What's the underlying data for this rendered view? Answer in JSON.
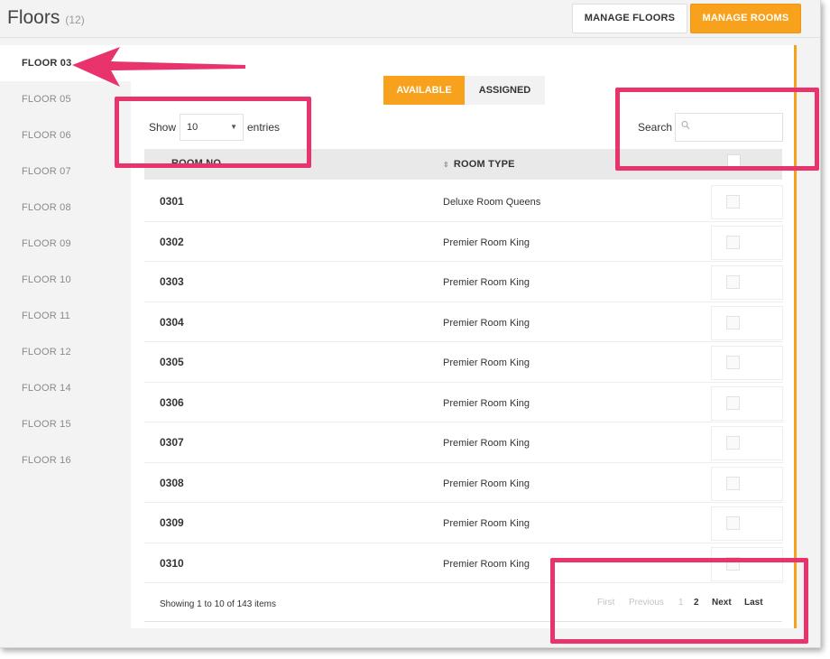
{
  "header": {
    "title": "Floors",
    "count": "(12)",
    "manage_floors_label": "MANAGE FLOORS",
    "manage_rooms_label": "MANAGE ROOMS"
  },
  "sidebar": {
    "items": [
      {
        "label": "FLOOR 03",
        "active": true
      },
      {
        "label": "FLOOR 05"
      },
      {
        "label": "FLOOR 06"
      },
      {
        "label": "FLOOR 07"
      },
      {
        "label": "FLOOR 08"
      },
      {
        "label": "FLOOR 09"
      },
      {
        "label": "FLOOR 10"
      },
      {
        "label": "FLOOR 11"
      },
      {
        "label": "FLOOR 12"
      },
      {
        "label": "FLOOR 14"
      },
      {
        "label": "FLOOR 15"
      },
      {
        "label": "FLOOR 16"
      }
    ]
  },
  "tabs": {
    "available": "AVAILABLE",
    "assigned": "ASSIGNED"
  },
  "controls": {
    "show_label": "Show",
    "page_size": "10",
    "entries_label": "entries",
    "search_label": "Search",
    "search_value": ""
  },
  "table": {
    "col_room": "ROOM NO",
    "col_type": "ROOM TYPE",
    "rows": [
      {
        "room": "0301",
        "type": "Deluxe Room Queens"
      },
      {
        "room": "0302",
        "type": "Premier Room King"
      },
      {
        "room": "0303",
        "type": "Premier Room King"
      },
      {
        "room": "0304",
        "type": "Premier Room King"
      },
      {
        "room": "0305",
        "type": "Premier Room King"
      },
      {
        "room": "0306",
        "type": "Premier Room King"
      },
      {
        "room": "0307",
        "type": "Premier Room King"
      },
      {
        "room": "0308",
        "type": "Premier Room King"
      },
      {
        "room": "0309",
        "type": "Premier Room King"
      },
      {
        "room": "0310",
        "type": "Premier Room King"
      }
    ]
  },
  "footer": {
    "showing": "Showing 1 to 10 of 143 items",
    "first": "First",
    "previous": "Previous",
    "page1": "1",
    "page2": "2",
    "next": "Next",
    "last": "Last"
  },
  "colors": {
    "accent": "#f8a11c",
    "annotation": "#e8336d"
  }
}
